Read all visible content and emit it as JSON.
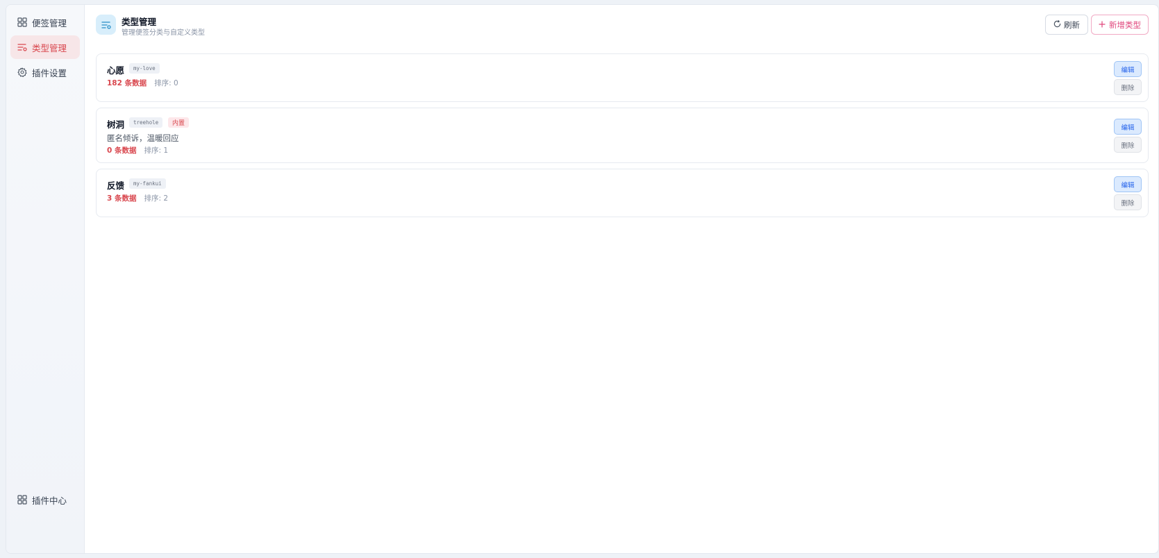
{
  "sidebar": {
    "items": [
      {
        "label": "便签管理",
        "icon": "grid-icon",
        "active": false
      },
      {
        "label": "类型管理",
        "icon": "list-filter-icon",
        "active": true
      },
      {
        "label": "插件设置",
        "icon": "gear-icon",
        "active": false
      }
    ],
    "footer": {
      "label": "插件中心",
      "icon": "grid-icon"
    }
  },
  "header": {
    "title": "类型管理",
    "subtitle": "管理便签分类与自定义类型",
    "refresh_label": "刷新",
    "add_label": "新增类型"
  },
  "types": [
    {
      "name": "心愿",
      "key": "my-love",
      "builtin": false,
      "builtin_label": "",
      "description": "",
      "count": "182 条数据",
      "sort": "排序: 0",
      "edit_label": "编辑",
      "delete_label": "删除"
    },
    {
      "name": "树洞",
      "key": "treehole",
      "builtin": true,
      "builtin_label": "内置",
      "description": "匿名倾诉，温暖回应",
      "count": "0 条数据",
      "sort": "排序: 1",
      "edit_label": "编辑",
      "delete_label": "删除"
    },
    {
      "name": "反馈",
      "key": "my-fankui",
      "builtin": false,
      "builtin_label": "",
      "description": "",
      "count": "3 条数据",
      "sort": "排序: 2",
      "edit_label": "编辑",
      "delete_label": "删除"
    }
  ],
  "colors": {
    "accent": "#d9484f",
    "add_button": "#e0457b",
    "edit_button": "#2563eb",
    "active_nav_bg": "#f7e6e8"
  }
}
